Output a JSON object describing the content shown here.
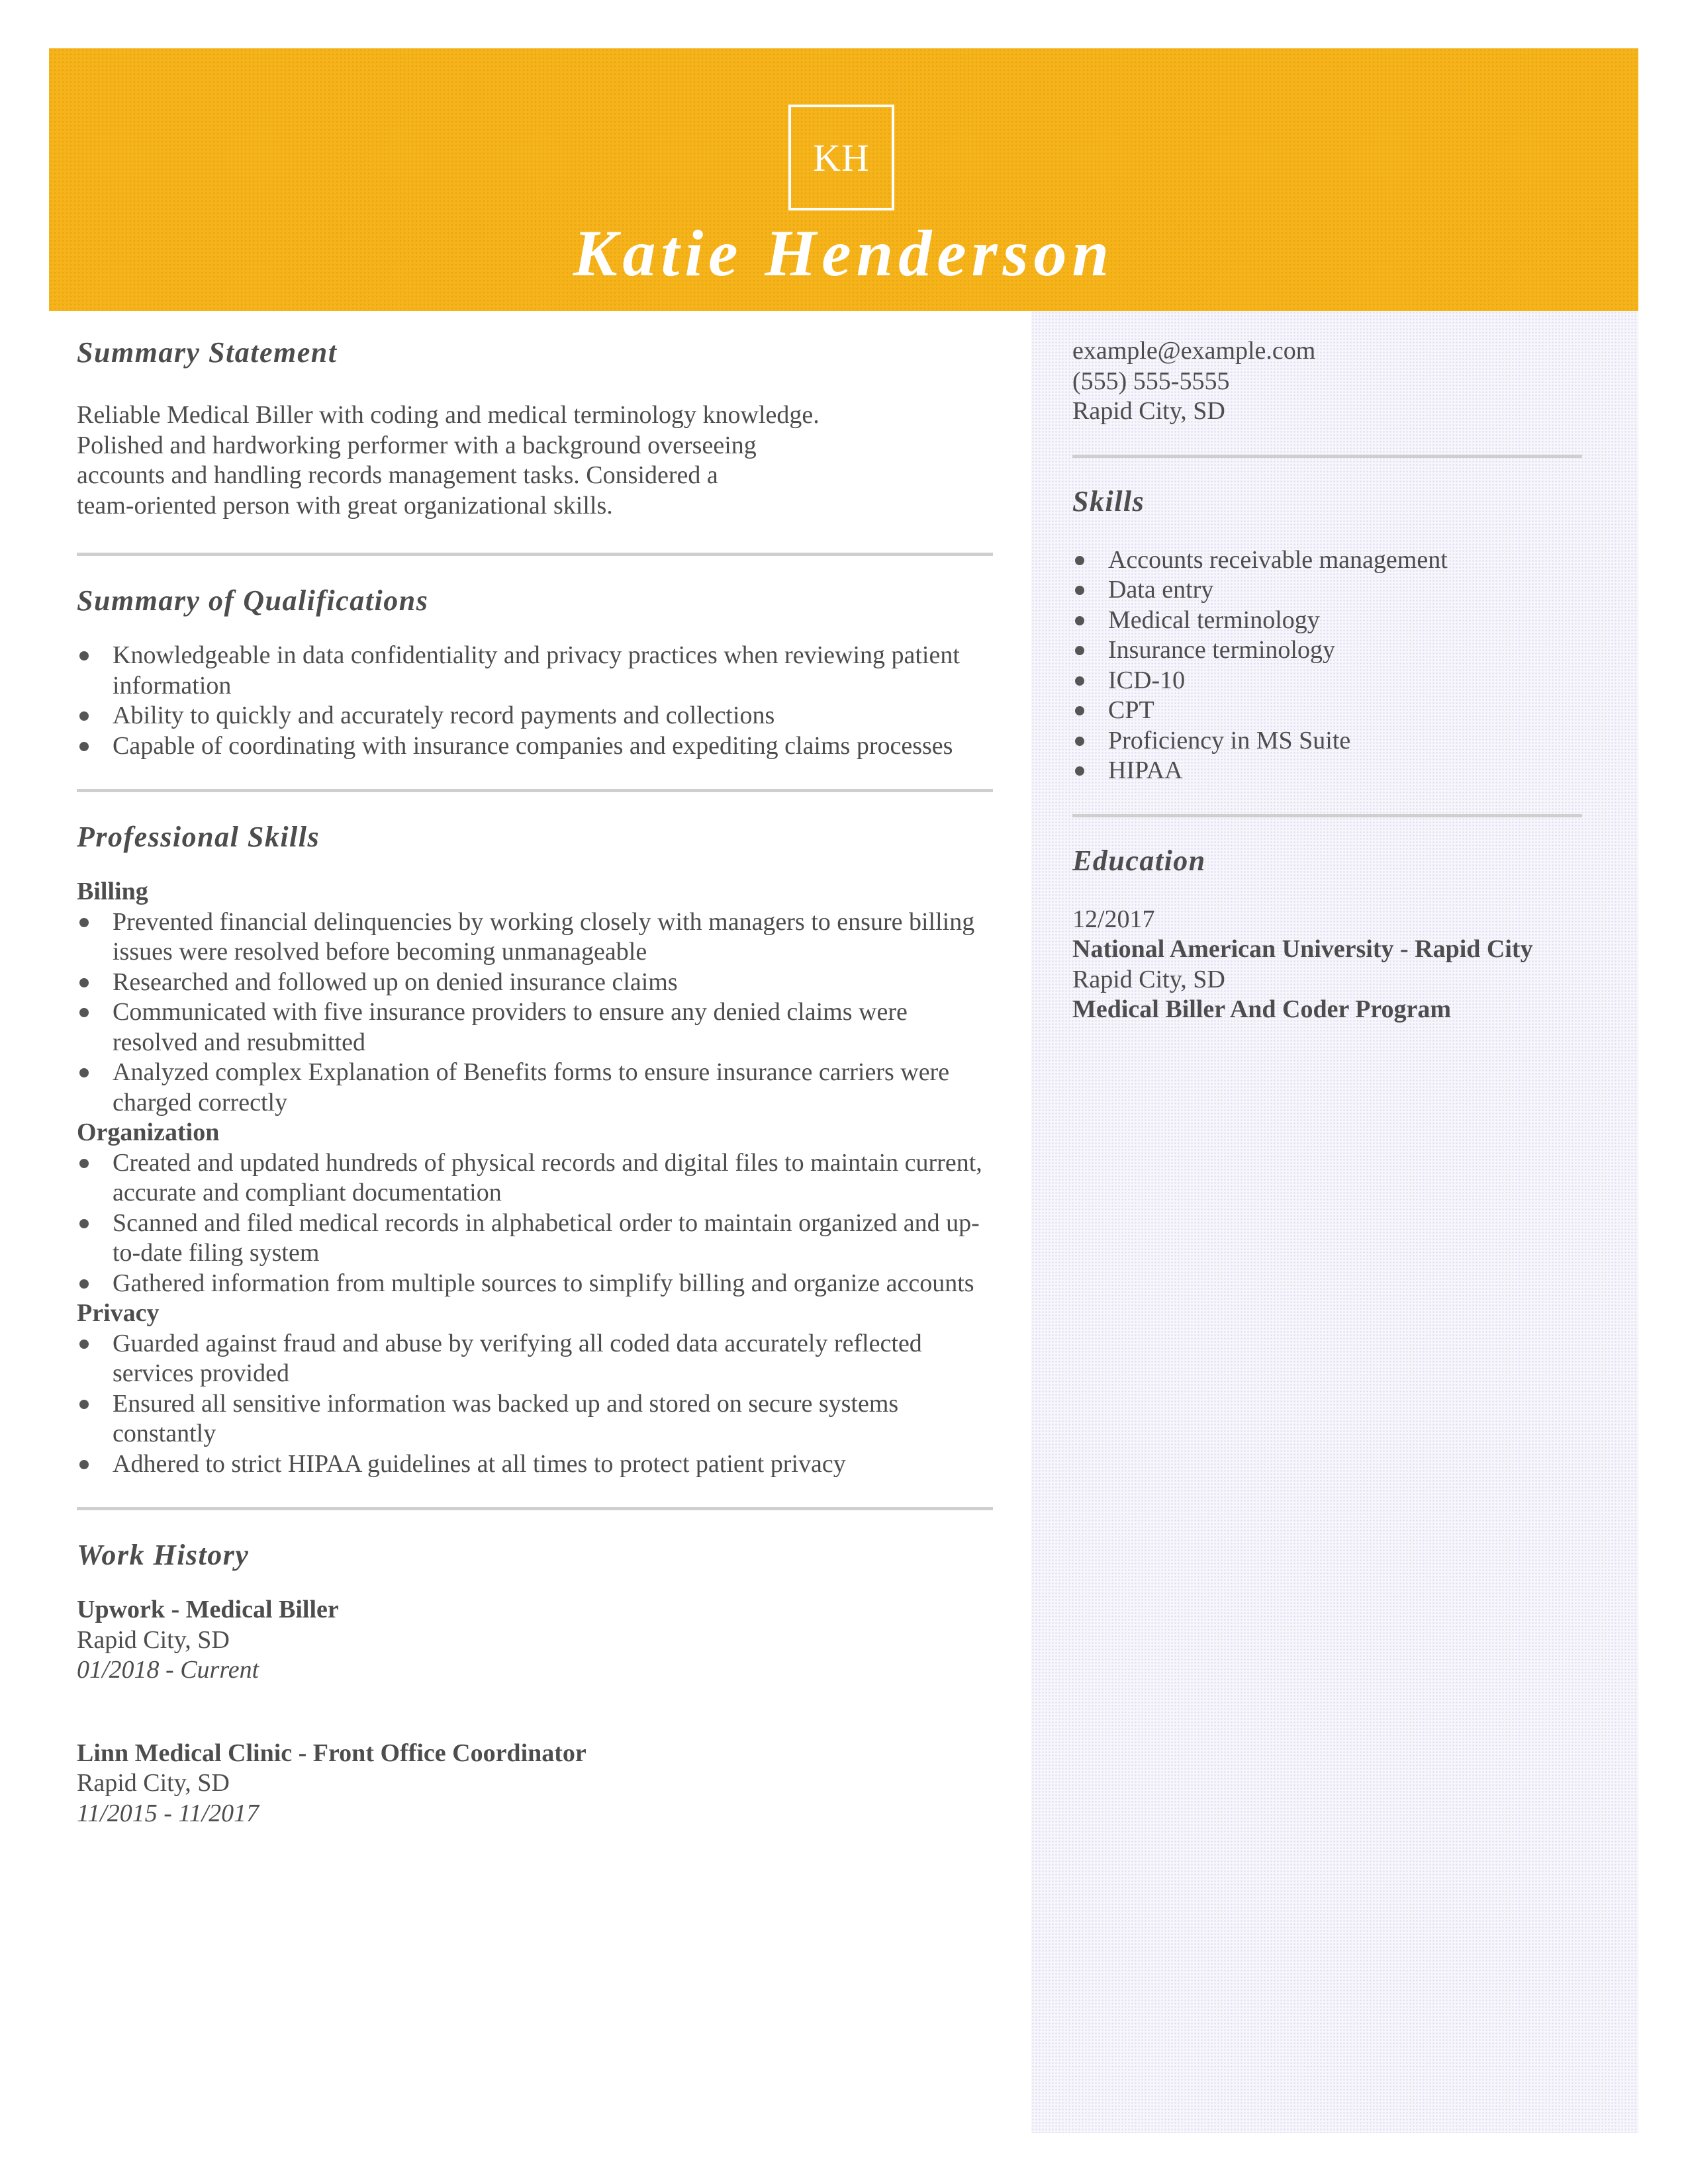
{
  "header": {
    "monogram": "KH",
    "name": "Katie Henderson",
    "accent_color": "#f4b41a"
  },
  "contact": {
    "email": "example@example.com",
    "phone": "(555) 555-5555",
    "location": "Rapid City, SD"
  },
  "summary": {
    "title": "Summary Statement",
    "lines": [
      "Reliable Medical Biller with coding and medical terminology knowledge.",
      "Polished and hardworking performer with a background overseeing",
      "accounts and handling records management tasks. Considered a",
      "team-oriented person with great organizational skills."
    ]
  },
  "qualifications": {
    "title": "Summary of Qualifications",
    "items": [
      "Knowledgeable in data confidentiality and privacy practices when reviewing patient information",
      "Ability to quickly and accurately record payments and collections",
      "Capable of coordinating with insurance companies and expediting claims processes"
    ]
  },
  "professional_skills": {
    "title": "Professional Skills",
    "groups": [
      {
        "name": "Billing",
        "items": [
          "Prevented financial delinquencies by working closely with managers to ensure billing issues were resolved before becoming unmanageable",
          "Researched and followed up on denied insurance claims",
          "Communicated with five insurance providers to ensure any denied claims were resolved and resubmitted",
          "Analyzed complex Explanation of Benefits forms to ensure insurance carriers were charged correctly"
        ]
      },
      {
        "name": "Organization",
        "items": [
          "Created and updated hundreds of physical records and digital files to maintain current, accurate and compliant documentation",
          "Scanned and filed medical records in alphabetical order to maintain organized and up-to-date filing system",
          "Gathered information from multiple sources to simplify billing and organize accounts"
        ]
      },
      {
        "name": "Privacy",
        "items": [
          "Guarded against fraud and abuse by verifying all coded data accurately reflected services provided",
          "Ensured all sensitive information was backed up and stored on secure systems constantly",
          "Adhered to strict HIPAA guidelines at all times to protect patient privacy"
        ]
      }
    ]
  },
  "work_history": {
    "title": "Work History",
    "jobs": [
      {
        "title": "Upwork - Medical Biller",
        "location": "Rapid City, SD",
        "dates": "01/2018 - Current"
      },
      {
        "title": "Linn Medical Clinic - Front Office Coordinator",
        "location": "Rapid City, SD",
        "dates": "11/2015 - 11/2017"
      }
    ]
  },
  "skills": {
    "title": "Skills",
    "items": [
      "Accounts receivable management",
      "Data entry",
      "Medical terminology",
      "Insurance terminology",
      "ICD-10",
      "CPT",
      "Proficiency in MS Suite",
      "HIPAA"
    ]
  },
  "education": {
    "title": "Education",
    "date": "12/2017",
    "school": "National American University - Rapid City",
    "location": "Rapid City, SD",
    "program": "Medical Biller And Coder Program"
  }
}
